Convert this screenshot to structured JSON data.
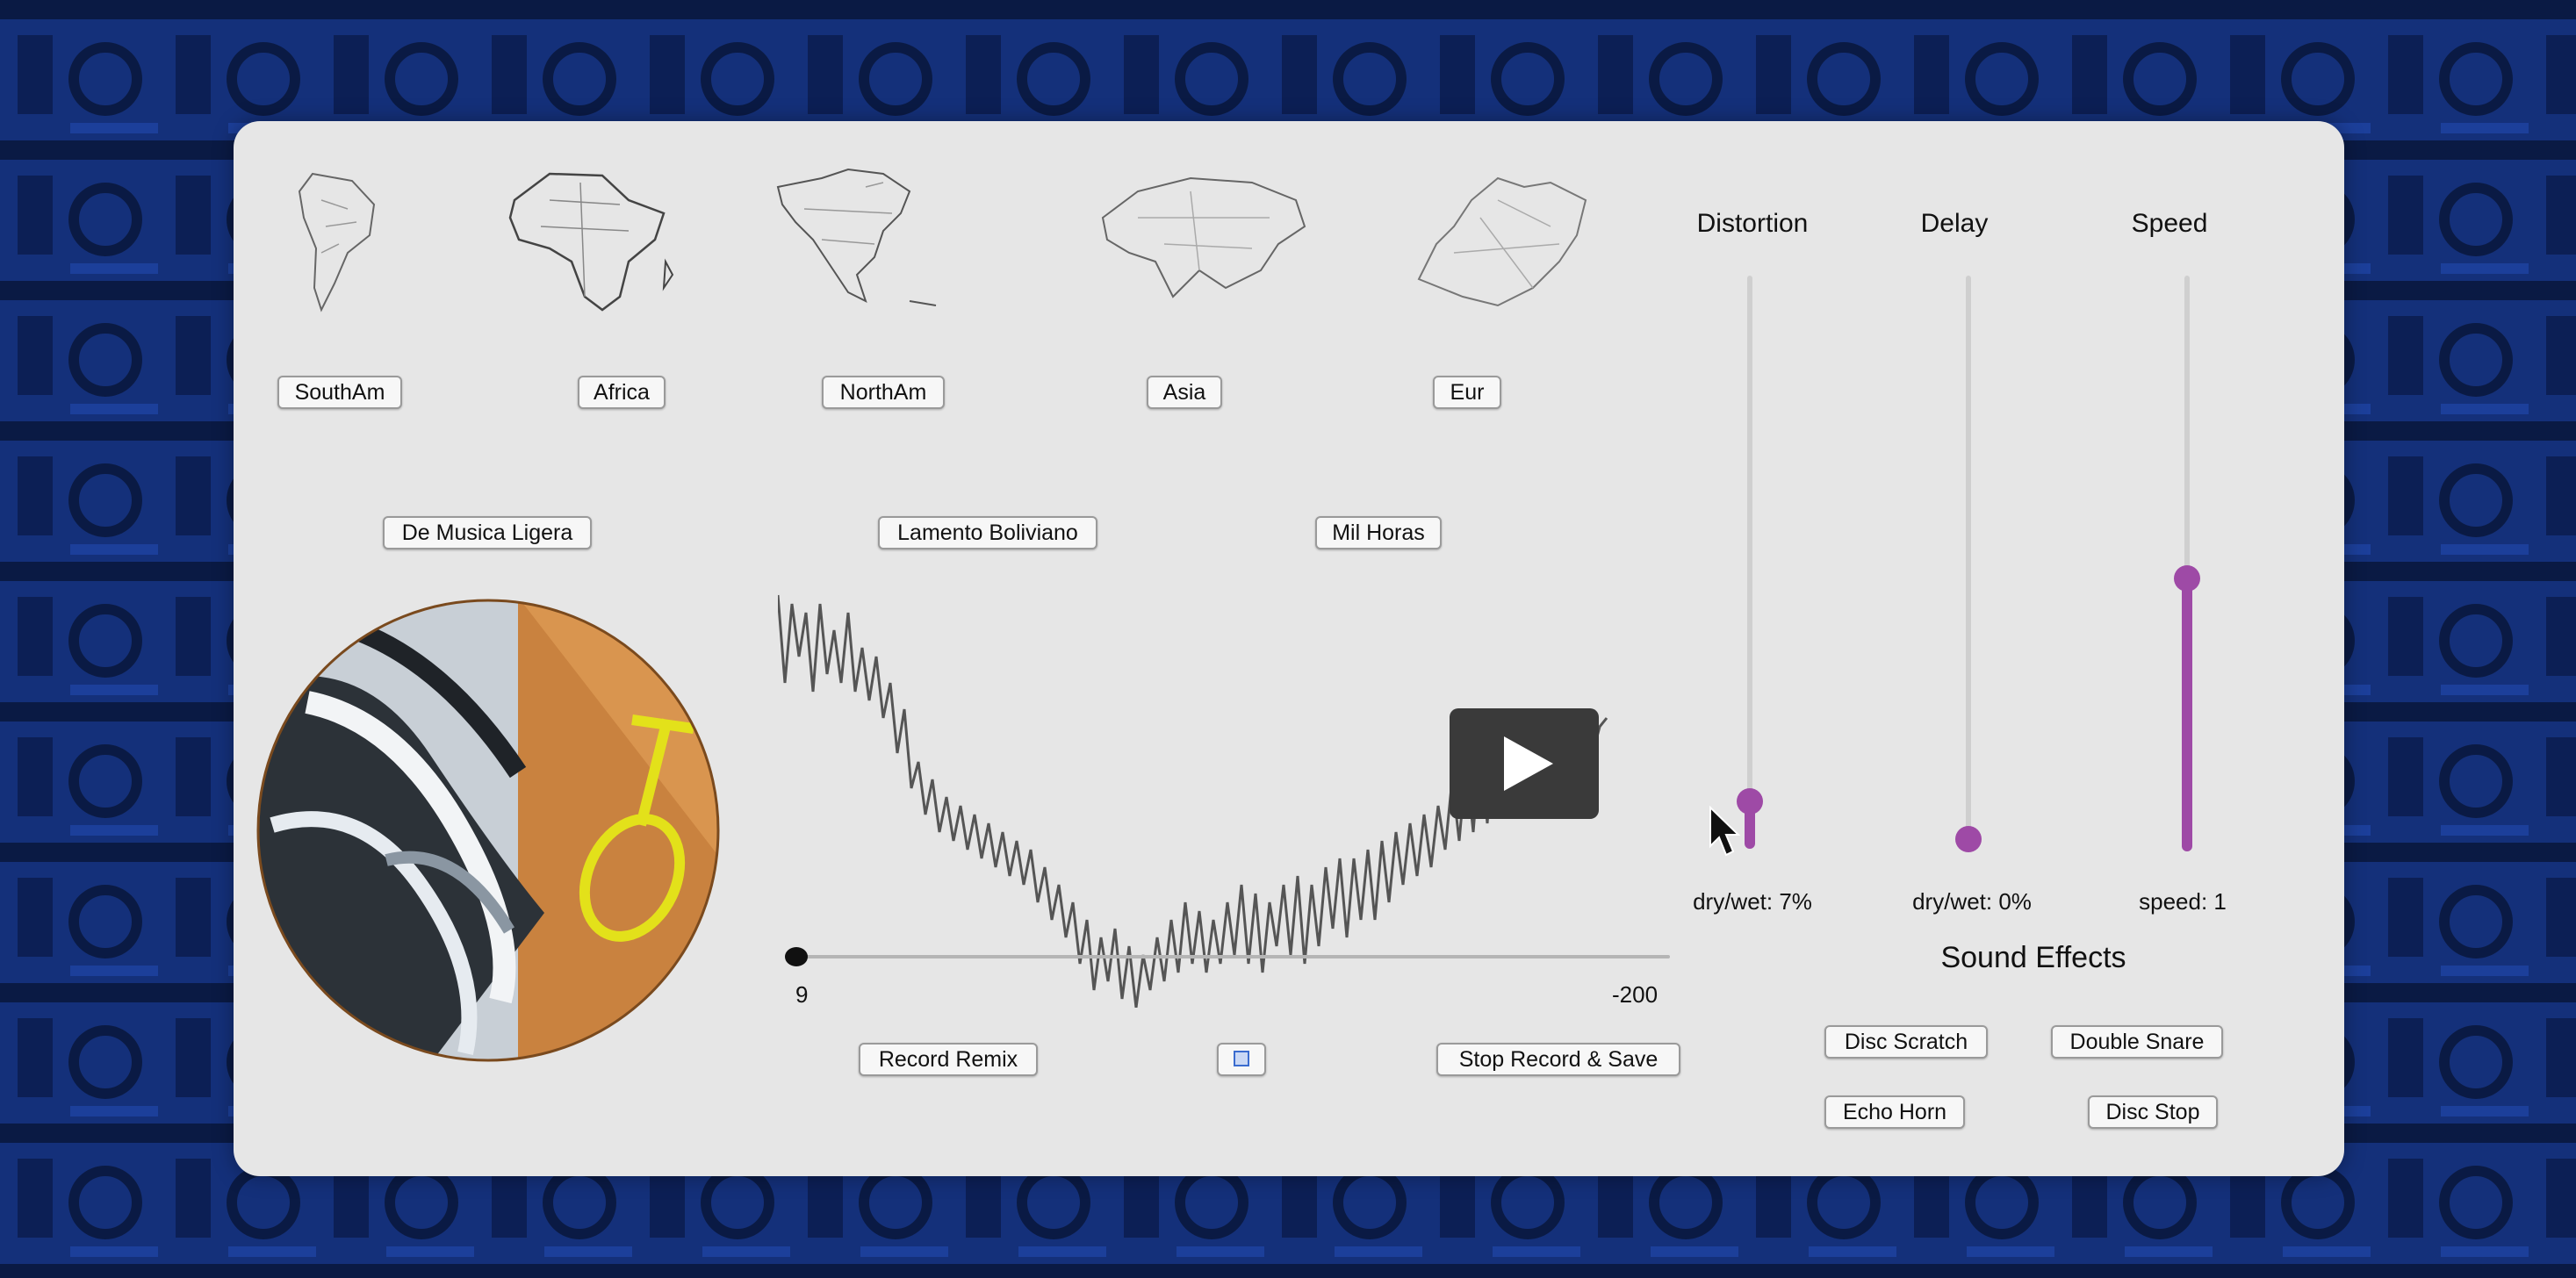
{
  "regions": {
    "buttons": [
      "SouthAm",
      "Africa",
      "NorthAm",
      "Asia",
      "Eur"
    ]
  },
  "tracks": [
    "De Musica Ligera",
    "Lamento Boliviano",
    "Mil Horas"
  ],
  "sliders": {
    "distortion": {
      "label": "Distortion",
      "readout": "dry/wet: 7%",
      "value_fraction": 0.07
    },
    "delay": {
      "label": "Delay",
      "readout": "dry/wet: 0%",
      "value_fraction": 0.0
    },
    "speed": {
      "label": "Speed",
      "readout": "speed: 1",
      "value_fraction": 0.5
    }
  },
  "playback": {
    "start_label": "9",
    "end_label": "-200",
    "progress_fraction": 0.0
  },
  "recording": {
    "record_label": "Record Remix",
    "stop_label": "Stop Record & Save"
  },
  "sound_effects": {
    "title": "Sound Effects",
    "buttons": [
      "Disc Scratch",
      "Double Snare",
      "Echo Horn",
      "Disc Stop"
    ]
  },
  "colors": {
    "accent": "#9e4aa6",
    "panel": "#e6e6e6",
    "background": "#0f2460"
  },
  "icons": [
    "play-icon",
    "cursor-icon",
    "vinyl-disc-image",
    "waveform-graphic"
  ]
}
